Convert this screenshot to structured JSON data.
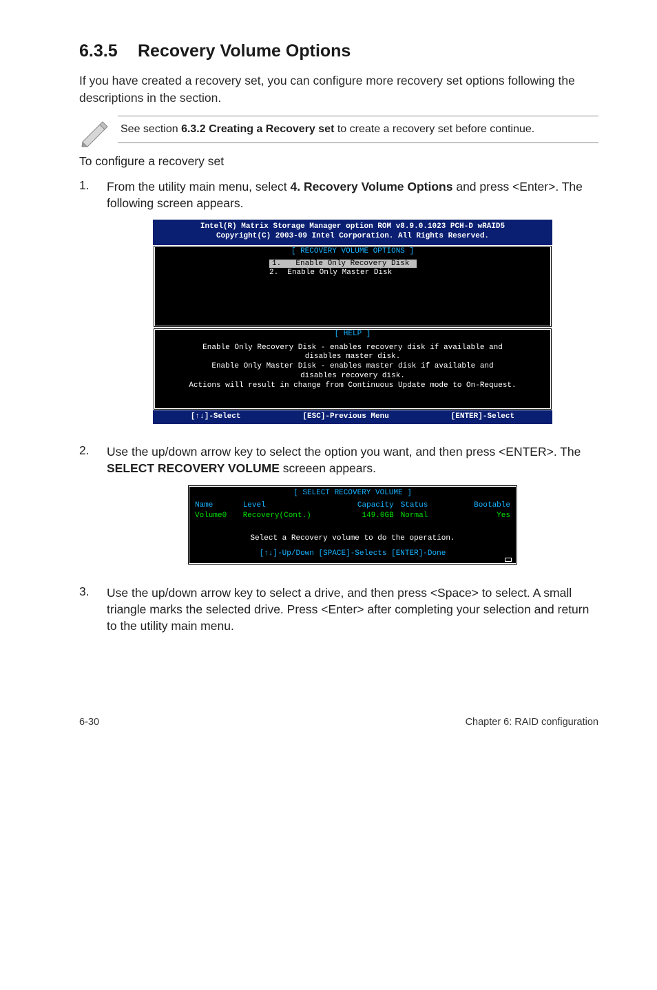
{
  "heading": {
    "number": "6.3.5",
    "title": "Recovery Volume Options"
  },
  "intro": "If you have created a recovery set, you can configure more recovery set options following the descriptions in the section.",
  "note": {
    "prefix": "See section ",
    "bold": "6.3.2 Creating a Recovery set",
    "suffix": " to create a recovery set before continue."
  },
  "configure_line": "To configure a recovery set",
  "steps": {
    "s1": {
      "num": "1.",
      "pre": "From the utility main menu, select ",
      "bold": "4. Recovery Volume Options",
      "post": " and press <Enter>. The following screen appears."
    },
    "s2": {
      "num": "2.",
      "pre": "Use the up/down arrow key to select the option you want, and then press <ENTER>. The ",
      "bold": "SELECT RECOVERY VOLUME",
      "post": " screeen appears."
    },
    "s3": {
      "num": "3.",
      "text": "Use the up/down arrow key to select a drive, and then press <Space> to select. A small triangle marks the selected drive. Press <Enter> after completing your selection and return to the utility main menu."
    }
  },
  "bios1": {
    "header1": "Intel(R) Matrix Storage Manager option ROM v8.9.0.1023 PCH-D wRAID5",
    "header2": "Copyright(C) 2003-09 Intel Corporation.  All Rights Reserved.",
    "panel_title": "[ RECOVERY VOLUME OPTIONS ]",
    "opt1_num": "1.",
    "opt1": "  Enable Only Recovery Disk ",
    "opt2": "2.  Enable Only Master Disk",
    "help_title": "[ HELP ]",
    "help_text": "Enable Only Recovery Disk - enables recovery disk if available and\ndisables master disk.\nEnable Only Master Disk - enables master disk if available and\ndisables recovery disk.\nActions will result in change from Continuous Update mode to On-Request.",
    "foot1": "[↑↓]-Select",
    "foot2": "[ESC]-Previous Menu",
    "foot3": "[ENTER]-Select"
  },
  "bios2": {
    "panel_title": "[ SELECT RECOVERY VOLUME ]",
    "headers": {
      "name": "Name",
      "level": "Level",
      "capacity": "Capacity",
      "status": "Status",
      "bootable": "Bootable"
    },
    "row": {
      "name": "Volume0",
      "level": "Recovery(Cont.)",
      "capacity": "149.0GB",
      "status": "Normal",
      "bootable": "Yes"
    },
    "msg1": "Select a Recovery volume to do the operation.",
    "msg2": "[↑↓]-Up/Down [SPACE]-Selects [ENTER]-Done"
  },
  "footer": {
    "left": "6-30",
    "right": "Chapter 6: RAID configuration"
  }
}
